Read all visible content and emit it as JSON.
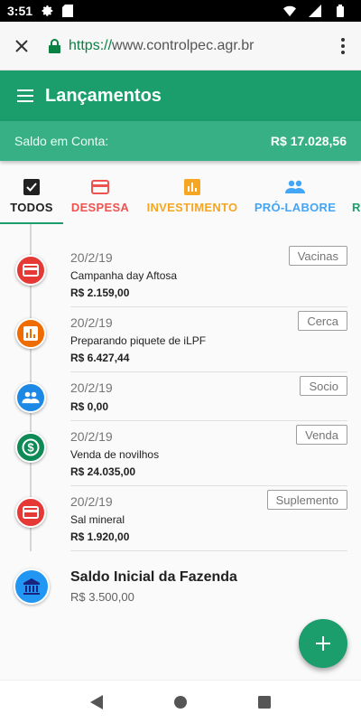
{
  "status_bar": {
    "time": "3:51",
    "icons": [
      "gear-icon",
      "sd-card-icon",
      "wifi-icon",
      "signal-icon",
      "battery-icon"
    ]
  },
  "browser": {
    "url_scheme": "https://",
    "url_host": "www.controlpec.agr.br"
  },
  "app_bar": {
    "title": "Lançamentos"
  },
  "balance": {
    "label": "Saldo em Conta:",
    "value": "R$ 17.028,56"
  },
  "tabs": [
    {
      "label": "TODOS",
      "color": "#212121",
      "icon": "checkbox-icon",
      "active": true
    },
    {
      "label": "DESPESA",
      "color": "#ef5350",
      "icon": "credit-card-icon",
      "active": false
    },
    {
      "label": "INVESTIMENTO",
      "color": "#f5a623",
      "icon": "bar-chart-icon",
      "active": false
    },
    {
      "label": "PRÓ-LABORE",
      "color": "#42a5f5",
      "icon": "people-icon",
      "active": false
    },
    {
      "label": "R",
      "color": "#1b9e6c",
      "icon": "",
      "active": false
    }
  ],
  "entries": [
    {
      "date": "20/2/19",
      "description": "Campanha day Aftosa",
      "amount": "R$ 2.159,00",
      "tag": "Vacinas",
      "type": "despesa",
      "icon": "credit-card-icon",
      "color": "#e53935"
    },
    {
      "date": "20/2/19",
      "description": "Preparando piquete de iLPF",
      "amount": "R$ 6.427,44",
      "tag": "Cerca",
      "type": "investimento",
      "icon": "bar-chart-icon",
      "color": "#ef6c00"
    },
    {
      "date": "20/2/19",
      "description": "",
      "amount": "R$ 0,00",
      "tag": "Socio",
      "type": "pro-labore",
      "icon": "people-icon",
      "color": "#1e88e5"
    },
    {
      "date": "20/2/19",
      "description": "Venda de novilhos",
      "amount": "R$ 24.035,00",
      "tag": "Venda",
      "type": "receita",
      "icon": "dollar-icon",
      "color": "#0d8a55"
    },
    {
      "date": "20/2/19",
      "description": "Sal mineral",
      "amount": "R$ 1.920,00",
      "tag": "Suplemento",
      "type": "despesa",
      "icon": "credit-card-icon",
      "color": "#e53935"
    }
  ],
  "initial_balance": {
    "title": "Saldo Inicial da Fazenda",
    "value": "R$ 3.500,00",
    "icon": "bank-icon"
  },
  "fab": {
    "icon": "plus-icon"
  },
  "nav": {
    "icons": [
      "back-icon",
      "home-icon",
      "recents-icon"
    ]
  }
}
